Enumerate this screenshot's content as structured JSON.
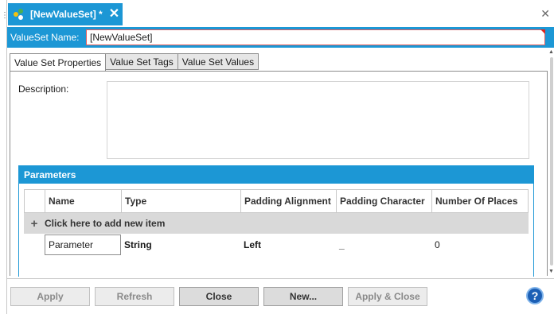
{
  "document_tab": {
    "title": "[NewValueSet] *"
  },
  "name_bar": {
    "label": "ValueSet  Name:",
    "value": "[NewValueSet]"
  },
  "tabs": [
    {
      "label": "Value Set Properties",
      "active": true
    },
    {
      "label": "Value Set Tags",
      "active": false
    },
    {
      "label": "Value Set Values",
      "active": false
    }
  ],
  "properties": {
    "description_label": "Description:",
    "description_value": ""
  },
  "parameters": {
    "header": "Parameters",
    "columns": [
      "Name",
      "Type",
      "Padding Alignment",
      "Padding Character",
      "Number Of Places"
    ],
    "add_row_label": "Click here to add new item",
    "rows": [
      {
        "name": "Parameter",
        "type": "String",
        "padding_alignment": "Left",
        "padding_character": "_",
        "number_of_places": "0"
      }
    ]
  },
  "footer": {
    "apply": "Apply",
    "refresh": "Refresh",
    "close": "Close",
    "new": "New...",
    "apply_close": "Apply & Close",
    "help": "?"
  },
  "colors": {
    "accent": "#1c97d5",
    "help": "#1c5fb5"
  }
}
